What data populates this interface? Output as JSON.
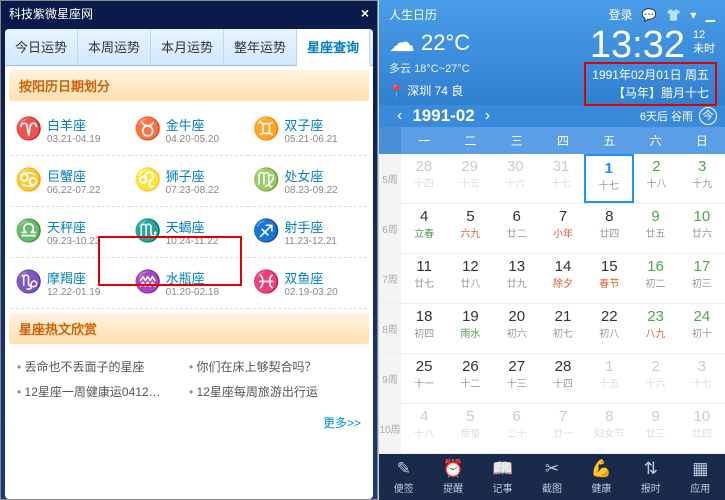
{
  "left": {
    "title": "科技紫微星座网",
    "tabs": [
      "今日运势",
      "本周运势",
      "本月运势",
      "整年运势",
      "星座查询"
    ],
    "activeTab": 4,
    "sectionByDate": "按阳历日期划分",
    "zodiac": [
      {
        "sym": "♈",
        "name": "白羊座",
        "date": "03.21-04.19"
      },
      {
        "sym": "♉",
        "name": "金牛座",
        "date": "04.20-05.20"
      },
      {
        "sym": "♊",
        "name": "双子座",
        "date": "05.21-06.21"
      },
      {
        "sym": "♋",
        "name": "巨蟹座",
        "date": "06.22-07.22"
      },
      {
        "sym": "♌",
        "name": "狮子座",
        "date": "07.23-08.22"
      },
      {
        "sym": "♍",
        "name": "处女座",
        "date": "08.23-09.22"
      },
      {
        "sym": "♎",
        "name": "天秤座",
        "date": "09.23-10.23"
      },
      {
        "sym": "♏",
        "name": "天蝎座",
        "date": "10.24-11.22"
      },
      {
        "sym": "♐",
        "name": "射手座",
        "date": "11.23-12.21"
      },
      {
        "sym": "♑",
        "name": "摩羯座",
        "date": "12.22-01.19"
      },
      {
        "sym": "♒",
        "name": "水瓶座",
        "date": "01.20-02.18"
      },
      {
        "sym": "♓",
        "name": "双鱼座",
        "date": "02.19-03.20"
      }
    ],
    "sectionHot": "星座热文欣赏",
    "articles": [
      "丢命也不丢面子的星座",
      "你们在床上够契合吗？",
      "12星座一周健康运0412…",
      "12星座每周旅游出行运"
    ],
    "more": "更多>>"
  },
  "right": {
    "title": "人生日历",
    "login": "登录",
    "weatherIcon": "☁",
    "tempNow": "22°C",
    "cond": "多云",
    "tempRange": "18°C~27°C",
    "loc": "深圳 74 良",
    "clock": "13:32",
    "clockDay": "12",
    "clockHour": "未时",
    "dateLine1": "1991年02月01日  周五",
    "dateLine2": "【马年】腊月十七",
    "navMonth": "1991-02",
    "navNote": "6天后 谷雨",
    "todayBtn": "今",
    "dow": [
      "一",
      "二",
      "三",
      "四",
      "五",
      "六",
      "日"
    ],
    "weeks": [
      {
        "lbl": "5周",
        "days": [
          {
            "n": "28",
            "s": "十四",
            "dim": 1
          },
          {
            "n": "29",
            "s": "十五",
            "dim": 1
          },
          {
            "n": "30",
            "s": "十六",
            "dim": 1
          },
          {
            "n": "31",
            "s": "十七",
            "dim": 1
          },
          {
            "n": "1",
            "s": "十七",
            "sel": 1
          },
          {
            "n": "2",
            "s": "十八",
            "wk": 1
          },
          {
            "n": "3",
            "s": "十九",
            "wk": 1
          }
        ]
      },
      {
        "lbl": "6周",
        "days": [
          {
            "n": "4",
            "s": "立春",
            "sc": "green"
          },
          {
            "n": "5",
            "s": "六九",
            "sc": "red"
          },
          {
            "n": "6",
            "s": "廿二"
          },
          {
            "n": "7",
            "s": "小年",
            "sc": "red"
          },
          {
            "n": "8",
            "s": "廿四"
          },
          {
            "n": "9",
            "s": "廿五",
            "wk": 1
          },
          {
            "n": "10",
            "s": "廿六",
            "wk": 1
          }
        ]
      },
      {
        "lbl": "7周",
        "days": [
          {
            "n": "11",
            "s": "廿七"
          },
          {
            "n": "12",
            "s": "廿八"
          },
          {
            "n": "13",
            "s": "廿九"
          },
          {
            "n": "14",
            "s": "除夕",
            "sc": "red"
          },
          {
            "n": "15",
            "s": "春节",
            "sc": "red"
          },
          {
            "n": "16",
            "s": "初二",
            "wk": 1
          },
          {
            "n": "17",
            "s": "初三",
            "wk": 1
          }
        ]
      },
      {
        "lbl": "8周",
        "days": [
          {
            "n": "18",
            "s": "初四"
          },
          {
            "n": "19",
            "s": "雨水",
            "sc": "green"
          },
          {
            "n": "20",
            "s": "初六"
          },
          {
            "n": "21",
            "s": "初七"
          },
          {
            "n": "22",
            "s": "初八"
          },
          {
            "n": "23",
            "s": "八九",
            "sc": "red",
            "wk": 1
          },
          {
            "n": "24",
            "s": "初十",
            "wk": 1
          }
        ]
      },
      {
        "lbl": "9周",
        "days": [
          {
            "n": "25",
            "s": "十一"
          },
          {
            "n": "26",
            "s": "十二"
          },
          {
            "n": "27",
            "s": "十三"
          },
          {
            "n": "28",
            "s": "十四"
          },
          {
            "n": "1",
            "s": "十五",
            "dim": 1
          },
          {
            "n": "2",
            "s": "十六",
            "dim": 1
          },
          {
            "n": "3",
            "s": "十七",
            "dim": 1
          }
        ]
      },
      {
        "lbl": "10周",
        "days": [
          {
            "n": "4",
            "s": "十八",
            "dim": 1
          },
          {
            "n": "5",
            "s": "惊蛰",
            "dim": 1
          },
          {
            "n": "6",
            "s": "二十",
            "dim": 1
          },
          {
            "n": "7",
            "s": "廿一",
            "dim": 1
          },
          {
            "n": "8",
            "s": "妇女节",
            "dim": 1
          },
          {
            "n": "9",
            "s": "廿三",
            "dim": 1
          },
          {
            "n": "10",
            "s": "廿四",
            "dim": 1
          }
        ]
      }
    ],
    "toolbar": [
      {
        "i": "✎",
        "t": "便签"
      },
      {
        "i": "⏰",
        "t": "提醒"
      },
      {
        "i": "📖",
        "t": "记事"
      },
      {
        "i": "✂",
        "t": "截图"
      },
      {
        "i": "💪",
        "t": "健康"
      },
      {
        "i": "⇅",
        "t": "报时"
      },
      {
        "i": "▦",
        "t": "应用"
      }
    ]
  }
}
